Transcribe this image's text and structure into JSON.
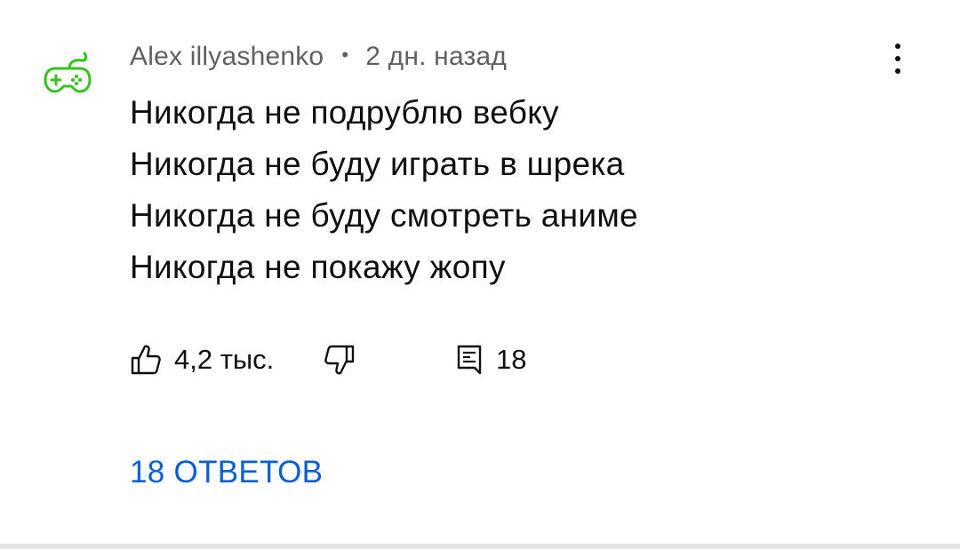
{
  "comment": {
    "author": "Alex illyashenko",
    "separator": "•",
    "timestamp": "2 дн. назад",
    "lines": [
      "Никогда не подрублю вебку",
      "Никогда не буду играть в шрека",
      "Никогда не буду смотреть аниме",
      "Никогда не покажу жопу"
    ],
    "likes": "4,2 тыс.",
    "reply_count": "18",
    "replies_link": "18 ОТВЕТОВ"
  },
  "icons": {
    "avatar": "gamepad-icon",
    "like": "thumb-up-icon",
    "dislike": "thumb-down-icon",
    "reply": "comment-icon",
    "menu": "more-vert-icon"
  },
  "colors": {
    "avatar_green": "#35c31f",
    "link_blue": "#065fd4",
    "meta_gray": "#606060",
    "text": "#0f0f0f"
  }
}
